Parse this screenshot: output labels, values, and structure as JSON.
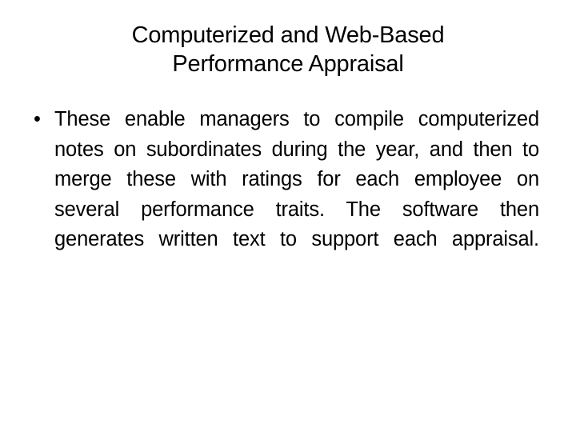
{
  "slide": {
    "background_color": "#ffffff",
    "text_color": "#000000",
    "title": {
      "line1": "Computerized and Web-Based",
      "line2": "Performance Appraisal",
      "full": "Computerized and Web-Based Performance Appraisal"
    },
    "body": {
      "bullet_marker": "•",
      "bullets": [
        {
          "text": "These enable managers to compile computerized notes on subordinates during the year, and then to merge these with ratings for each employee on several performance traits. The software then generates written text to support each appraisal.",
          "rendered_lines": [
            "These    enable    managers    to    compile",
            "computerized notes on subordinates during",
            "the year, and then to merge these with ratings",
            "for  each  employee  on  several  performance",
            "traits.  The  software  then  generates  written",
            "text to support each appraisal."
          ]
        }
      ]
    }
  }
}
